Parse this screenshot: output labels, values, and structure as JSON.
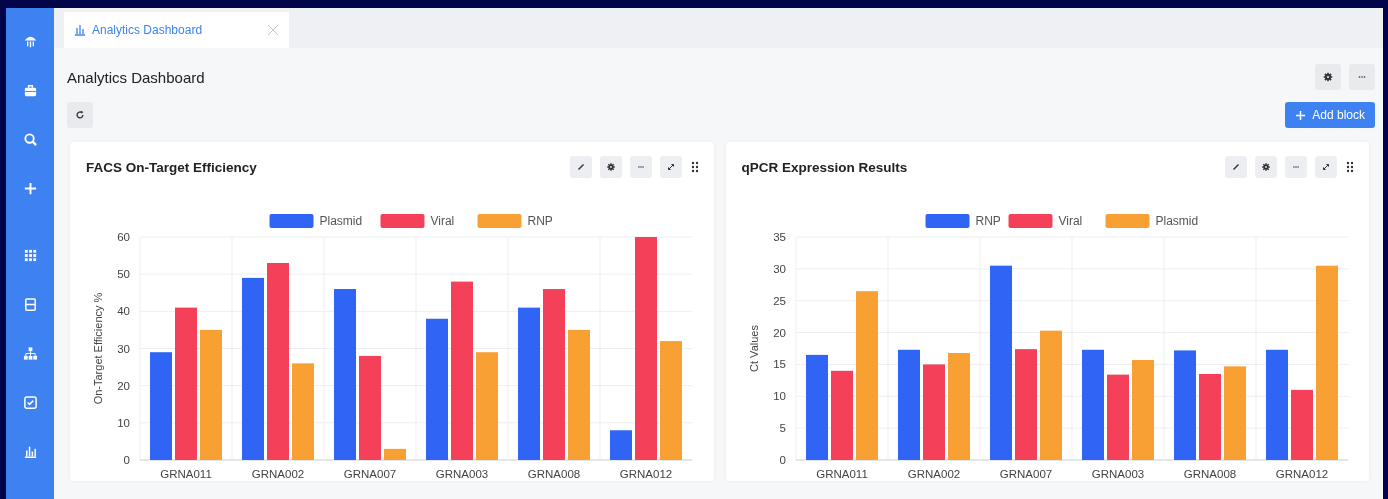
{
  "tabs": [
    {
      "label": "Analytics Dashboard",
      "selected": true
    }
  ],
  "page": {
    "title": "Analytics Dashboard",
    "add_button": "Add block"
  },
  "blocks": [
    {
      "title": "FACS On-Target Efficiency",
      "chart_data": {
        "type": "bar",
        "grid": true,
        "legend": true,
        "ylabel": "On-Target Efficiency %",
        "categories": [
          "GRNA011",
          "GRNA002",
          "GRNA007",
          "GRNA003",
          "GRNA008",
          "GRNA012"
        ],
        "ylim": [
          0,
          60
        ],
        "yticks": [
          0,
          10,
          20,
          30,
          40,
          50,
          60
        ],
        "series": [
          {
            "name": "Plasmid",
            "color": "#2f64f5",
            "values": [
              29,
              49,
              46,
              38,
              41,
              8
            ]
          },
          {
            "name": "Viral",
            "color": "#f5405a",
            "values": [
              41,
              53,
              28,
              48,
              46,
              60
            ]
          },
          {
            "name": "RNP",
            "color": "#f9a035",
            "values": [
              35,
              26,
              3,
              29,
              35,
              32
            ]
          }
        ]
      }
    },
    {
      "title": "qPCR Expression Results",
      "chart_data": {
        "type": "bar",
        "grid": true,
        "legend": true,
        "ylabel": "Ct Values",
        "categories": [
          "GRNA011",
          "GRNA002",
          "GRNA007",
          "GRNA003",
          "GRNA008",
          "GRNA012"
        ],
        "ylim": [
          0,
          35
        ],
        "yticks": [
          0,
          5,
          10,
          15,
          20,
          25,
          30,
          35
        ],
        "series": [
          {
            "name": "RNP",
            "color": "#2f64f5",
            "values": [
              16.5,
              17.3,
              30.5,
              17.3,
              17.2,
              17.3
            ]
          },
          {
            "name": "Viral",
            "color": "#f5405a",
            "values": [
              14,
              15,
              17.4,
              13.4,
              13.5,
              11
            ]
          },
          {
            "name": "Plasmid",
            "color": "#f9a035",
            "values": [
              26.5,
              16.8,
              20.3,
              15.7,
              14.7,
              30.5
            ]
          }
        ]
      }
    }
  ]
}
